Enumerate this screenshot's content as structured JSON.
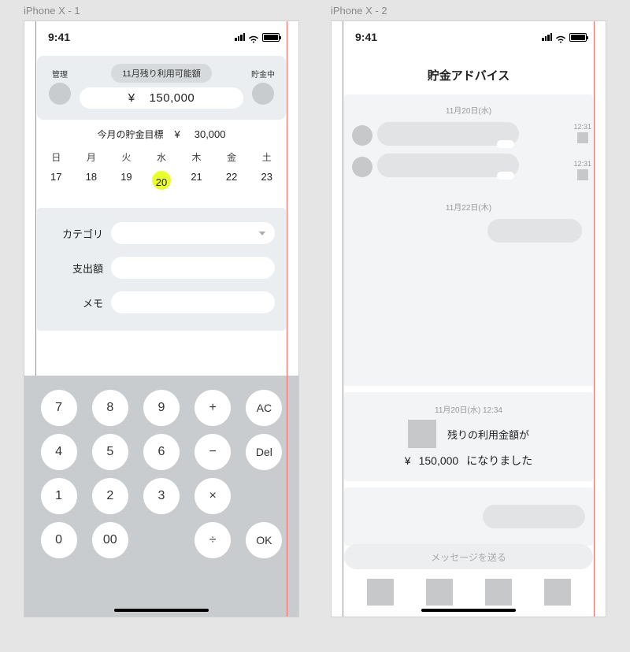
{
  "frames": {
    "f1_label": "iPhone X - 1",
    "f2_label": "iPhone X - 2"
  },
  "statusbar": {
    "time": "9:41"
  },
  "screen1": {
    "header": {
      "left_label": "管理",
      "right_label": "貯金中",
      "balance_title": "11月残り利用可能額",
      "currency": "¥",
      "balance": "150,000"
    },
    "goal": {
      "label": "今月の貯金目標",
      "currency": "¥",
      "amount": "30,000"
    },
    "calendar": {
      "days": [
        "日",
        "月",
        "火",
        "水",
        "木",
        "金",
        "土"
      ],
      "dates": [
        "17",
        "18",
        "19",
        "20",
        "21",
        "22",
        "23"
      ],
      "today_index": 3
    },
    "form": {
      "category_label": "カテゴリ",
      "amount_label": "支出額",
      "memo_label": "メモ"
    },
    "keypad": {
      "rows": [
        [
          "7",
          "8",
          "9",
          "+",
          "AC"
        ],
        [
          "4",
          "5",
          "6",
          "−",
          "Del"
        ],
        [
          "1",
          "2",
          "3",
          "×",
          ""
        ],
        [
          "0",
          "00",
          "",
          "÷",
          "OK"
        ]
      ]
    }
  },
  "screen2": {
    "title": "貯金アドバイス",
    "sep1": "11月20日(水)",
    "sep2": "11月22日(木)",
    "bubble_ts": "12:31",
    "notice": {
      "ts": "11月20日(水) 12:34",
      "line1": "残りの利用金額が",
      "currency": "¥",
      "amount": "150,000",
      "suffix": "になりました"
    },
    "compose_placeholder": "メッセージを送る"
  }
}
